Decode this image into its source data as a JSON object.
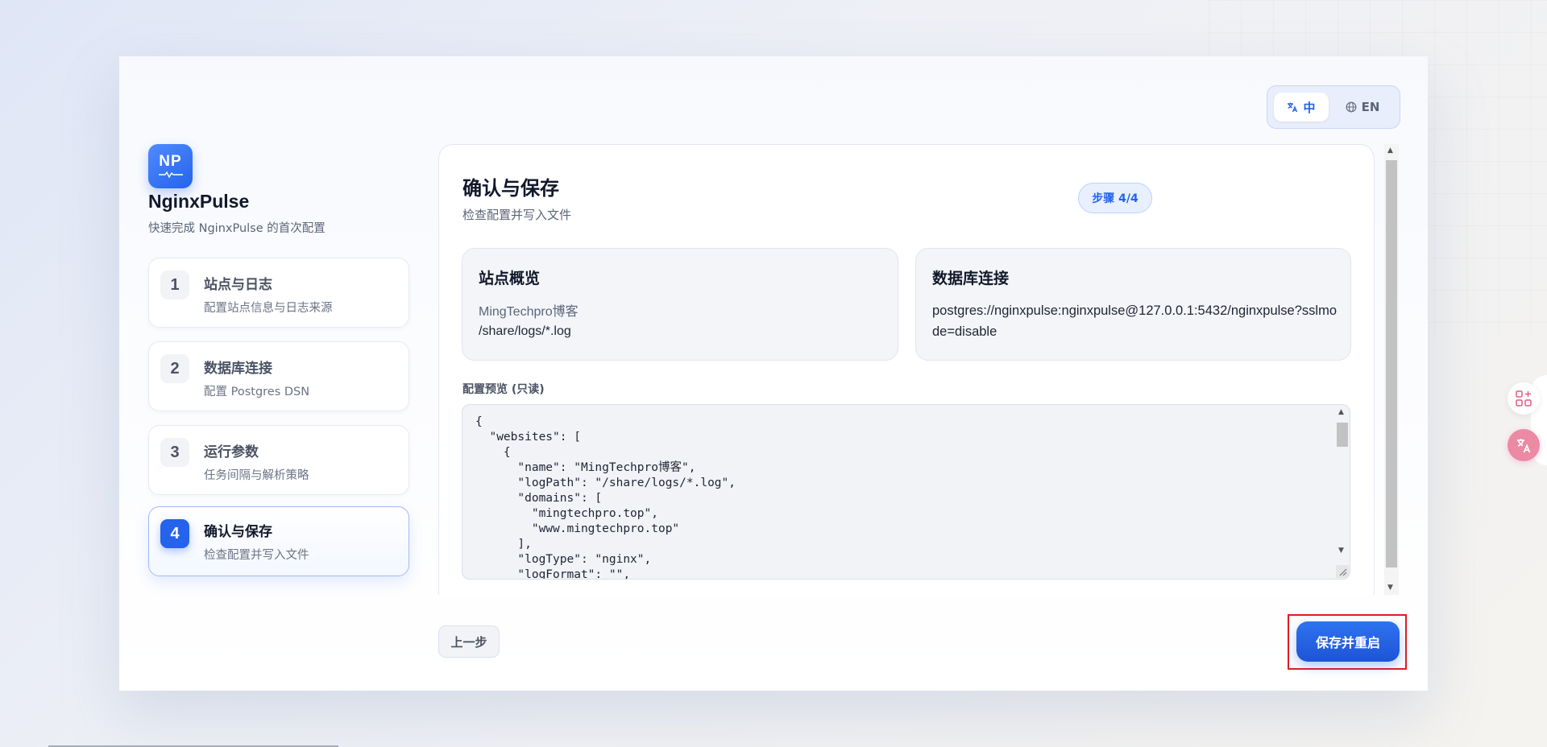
{
  "language_switch": {
    "zh_label": "中",
    "en_label": "EN"
  },
  "brand": {
    "logo_text": "NP",
    "name": "NginxPulse",
    "subtitle": "快速完成 NginxPulse 的首次配置"
  },
  "steps": [
    {
      "num": "1",
      "title": "站点与日志",
      "desc": "配置站点信息与日志来源"
    },
    {
      "num": "2",
      "title": "数据库连接",
      "desc": "配置 Postgres DSN"
    },
    {
      "num": "3",
      "title": "运行参数",
      "desc": "任务间隔与解析策略"
    },
    {
      "num": "4",
      "title": "确认与保存",
      "desc": "检查配置并写入文件"
    }
  ],
  "main": {
    "title": "确认与保存",
    "subtitle": "检查配置并写入文件",
    "step_badge": "步骤 4/4",
    "site_overview": {
      "title": "站点概览",
      "site_name": "MingTechpro博客",
      "log_path": "/share/logs/*.log"
    },
    "db_connection": {
      "title": "数据库连接",
      "dsn": "postgres://nginxpulse:nginxpulse@127.0.0.1:5432/nginxpulse?sslmode=disable"
    },
    "preview_label": "配置预览 (只读)",
    "preview_code": "{\n  \"websites\": [\n    {\n      \"name\": \"MingTechpro博客\",\n      \"logPath\": \"/share/logs/*.log\",\n      \"domains\": [\n        \"mingtechpro.top\",\n        \"www.mingtechpro.top\"\n      ],\n      \"logType\": \"nginx\",\n      \"logFormat\": \"\","
  },
  "footer": {
    "prev_label": "上一步",
    "save_label": "保存并重启"
  },
  "colors": {
    "accent": "#2563eb",
    "highlight_border": "#e31b23"
  }
}
